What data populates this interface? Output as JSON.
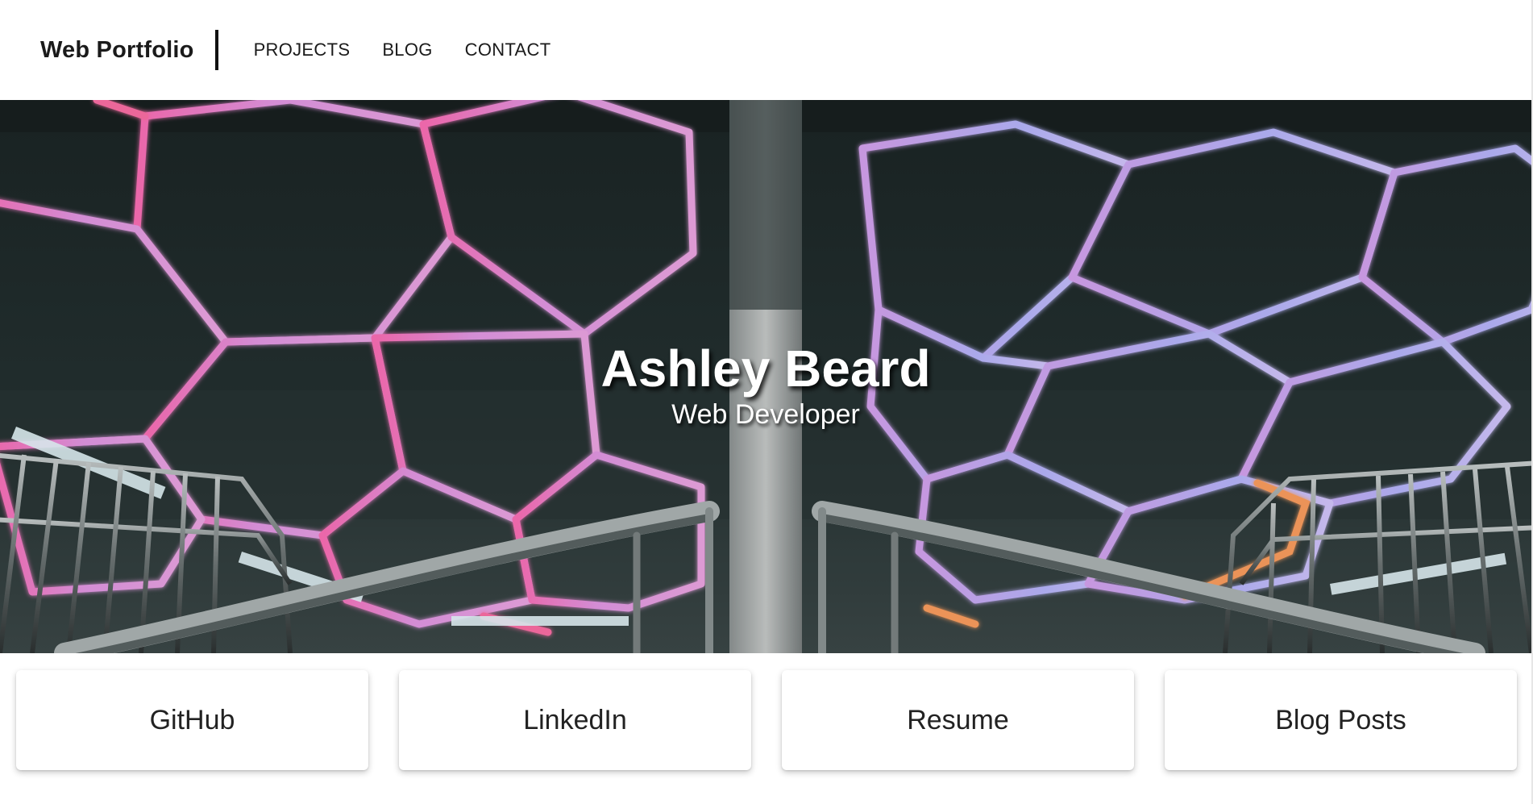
{
  "header": {
    "brand": "Web Portfolio",
    "nav": [
      {
        "label": "PROJECTS"
      },
      {
        "label": "BLOG"
      },
      {
        "label": "CONTACT"
      }
    ]
  },
  "hero": {
    "name": "Ashley Beard",
    "role": "Web Developer",
    "image_description_icon": "hexagon-ceiling-lights-photo"
  },
  "cards": [
    {
      "label": "GitHub"
    },
    {
      "label": "LinkedIn"
    },
    {
      "label": "Resume"
    },
    {
      "label": "Blog Posts"
    }
  ],
  "colors": {
    "hero_background": "#1f2a2a",
    "light_pink": "#ff7fd0",
    "light_violet": "#c9a8ff",
    "light_orange": "#ffa060",
    "card_text": "#222222"
  }
}
